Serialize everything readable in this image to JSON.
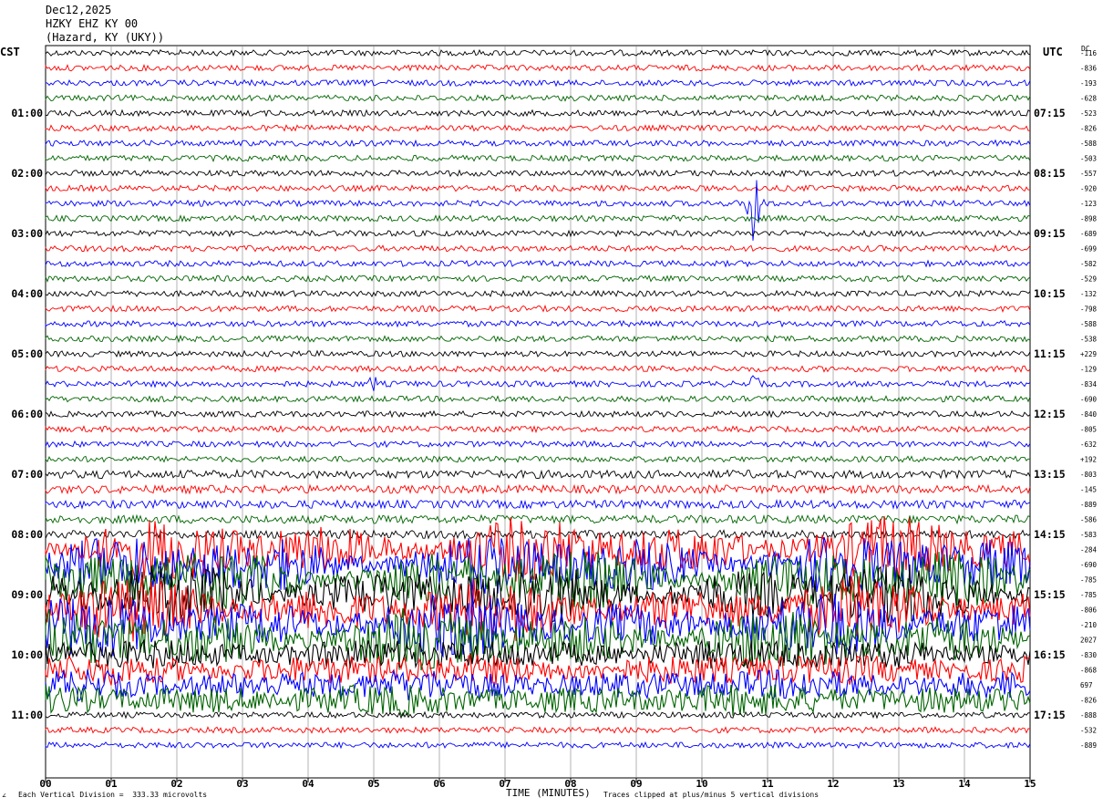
{
  "header": {
    "date": "Dec12,2025",
    "station": "HZKY EHZ KY 00",
    "location": "(Hazard, KY (UKY))"
  },
  "left_tz": "CST",
  "right_tz": "UTC",
  "dc_label": "DC",
  "footer": {
    "scale": "Each Vertical Division =  333.33 microvolts",
    "xlabel": "TIME (MINUTES)",
    "clip_note": "Traces clipped at plus/minus 5 vertical divisions",
    "corner_mark": "∠"
  },
  "colors": {
    "black": "#000000",
    "red": "#ff0000",
    "blue": "#0000ff",
    "green": "#006400",
    "grid": "#808080"
  },
  "chart_data": {
    "type": "line",
    "title": "HZKY EHZ KY 00",
    "xlabel": "TIME (MINUTES)",
    "xlim": [
      0,
      15
    ],
    "x_ticks": [
      "00",
      "01",
      "02",
      "03",
      "04",
      "05",
      "06",
      "07",
      "08",
      "09",
      "10",
      "11",
      "12",
      "13",
      "14",
      "15"
    ],
    "rows_per_hour": 4,
    "minutes_per_row": 15,
    "trace_colors": [
      "black",
      "red",
      "blue",
      "green"
    ],
    "left_hour_labels": [
      "01:00",
      "02:00",
      "03:00",
      "04:00",
      "05:00",
      "06:00",
      "07:00",
      "08:00",
      "09:00",
      "10:00",
      "11:00"
    ],
    "right_hour_labels": [
      "07:15",
      "08:15",
      "09:15",
      "10:15",
      "11:15",
      "12:15",
      "13:15",
      "14:15",
      "15:15",
      "16:15",
      "17:15"
    ],
    "dc_offsets": [
      "-116",
      "-836",
      "-193",
      "-628",
      "-523",
      "-826",
      "-588",
      "-503",
      "-557",
      "-920",
      "-123",
      "-898",
      "-689",
      "-699",
      "-582",
      "-529",
      "-132",
      "-798",
      "-588",
      "-538",
      "+229",
      "-129",
      "-834",
      "-690",
      "-840",
      "-805",
      "-632",
      "+192",
      "-803",
      "-145",
      "-889",
      "-586",
      "-583",
      "-284",
      "-690",
      "-785",
      "-785",
      "-806",
      "-210",
      "2027",
      "-830",
      "-868",
      "697",
      "-826",
      "-888",
      "-532",
      "-889"
    ],
    "events": [
      {
        "label": "local event",
        "row": 10,
        "minute": 10.8,
        "amplitude": "clipped"
      },
      {
        "label": "small event",
        "row": 22,
        "minute": 5.0,
        "amplitude": "small"
      },
      {
        "label": "small event",
        "row": 22,
        "minute": 10.8,
        "amplitude": "small"
      }
    ],
    "noisy_rows_start": 33,
    "noisy_rows_end": 43
  }
}
